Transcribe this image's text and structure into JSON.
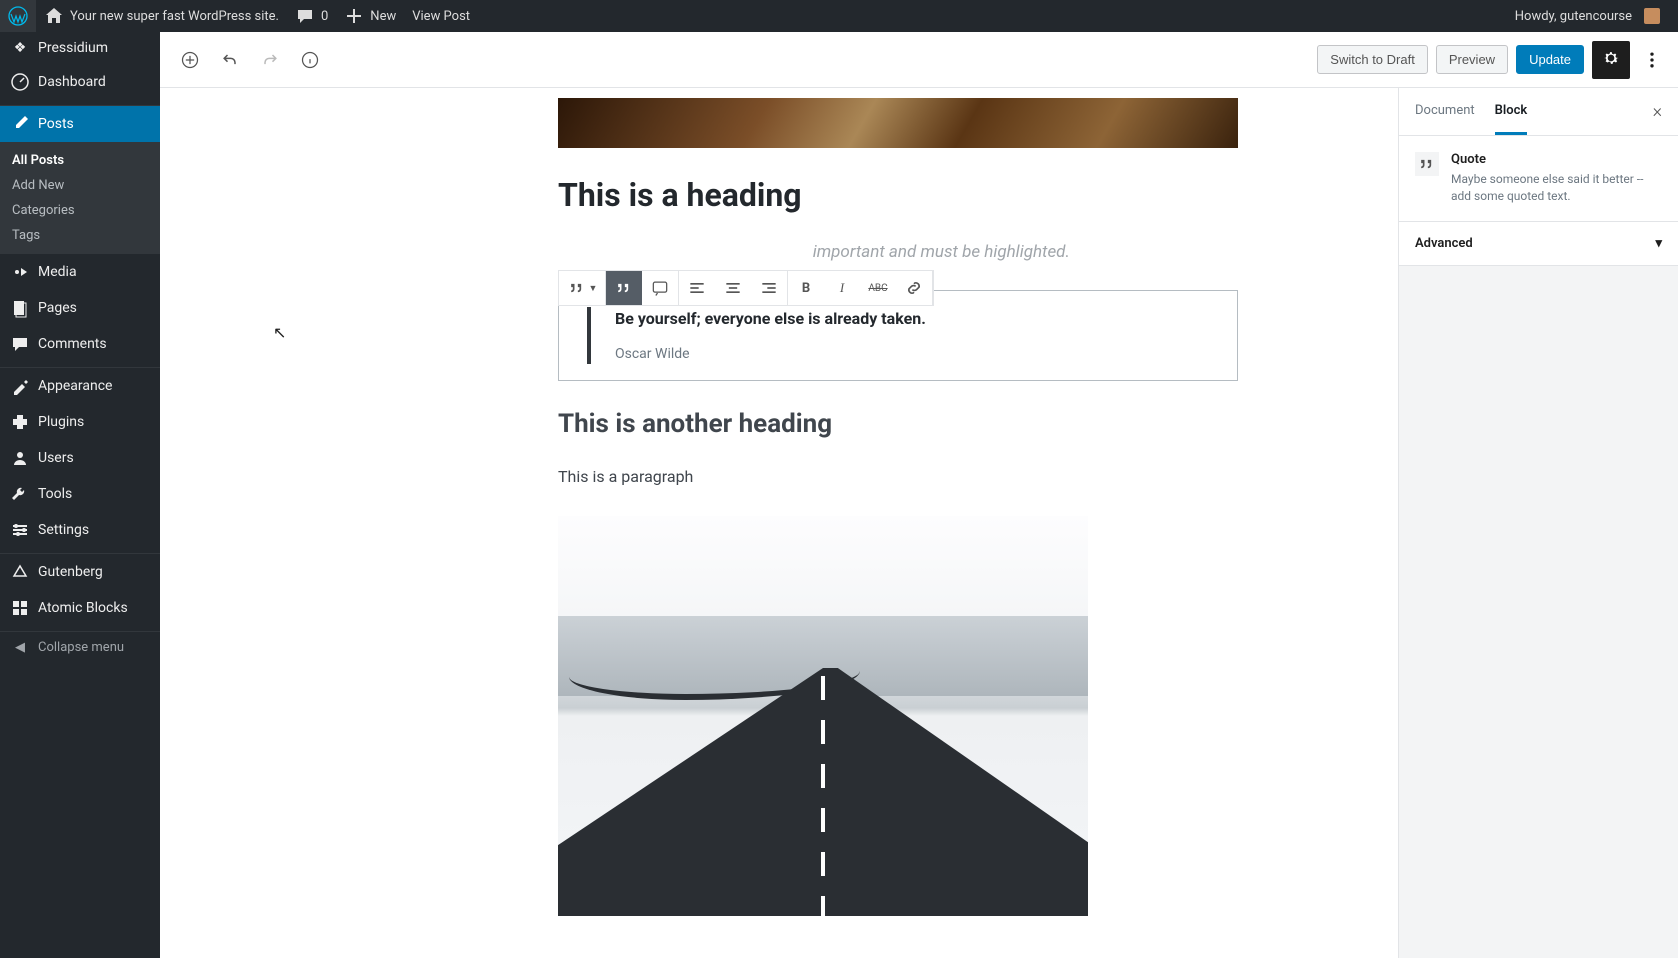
{
  "adminbar": {
    "site_title": "Your new super fast WordPress site.",
    "comments_count": "0",
    "new_label": "New",
    "view_post": "View Post",
    "howdy": "Howdy, gutencourse"
  },
  "sidebar": {
    "brand": "Pressidium",
    "dashboard": "Dashboard",
    "posts": "Posts",
    "posts_sub": {
      "all": "All Posts",
      "add": "Add New",
      "cats": "Categories",
      "tags": "Tags"
    },
    "media": "Media",
    "pages": "Pages",
    "comments": "Comments",
    "appearance": "Appearance",
    "plugins": "Plugins",
    "users": "Users",
    "tools": "Tools",
    "settings": "Settings",
    "gutenberg": "Gutenberg",
    "atomic": "Atomic Blocks",
    "collapse": "Collapse menu"
  },
  "header": {
    "switch_draft": "Switch to Draft",
    "preview": "Preview",
    "update": "Update"
  },
  "content": {
    "heading1": "This is a heading",
    "subheading_partial": "important and must be highlighted.",
    "quote_text": "Be yourself; everyone else is already taken.",
    "quote_cite": "Oscar Wilde",
    "heading2": "This is another heading",
    "paragraph": "This is a paragraph"
  },
  "settings": {
    "tab_document": "Document",
    "tab_block": "Block",
    "block_name": "Quote",
    "block_desc": "Maybe someone else said it better -- add some quoted text.",
    "advanced": "Advanced"
  }
}
